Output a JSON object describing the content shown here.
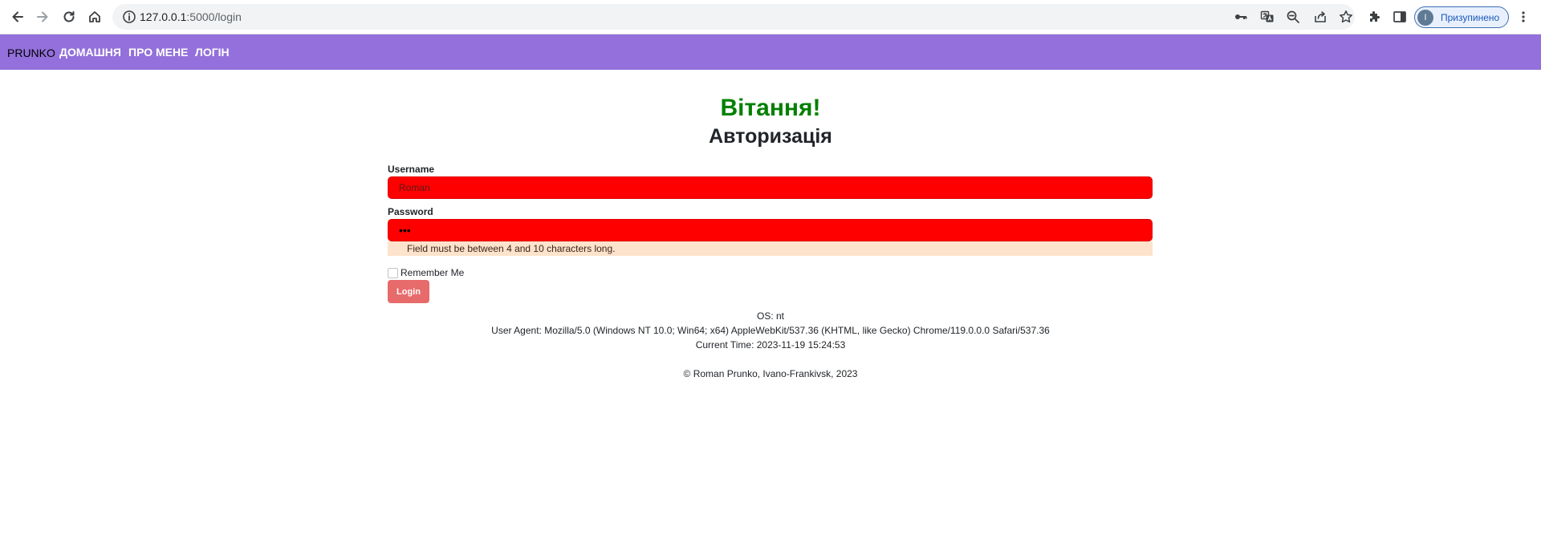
{
  "browser": {
    "url_host": "127.0.0.1",
    "url_rest": ":5000/login",
    "profile_initial": "I",
    "profile_label": "Призупинено"
  },
  "navbar": {
    "brand": "PRUNKO",
    "links": [
      "ДОМАШНЯ",
      "ПРО МЕНЕ",
      "ЛОГІН"
    ],
    "background": "#9370db"
  },
  "page": {
    "greeting": "Вітання!",
    "title": "Авторизація"
  },
  "form": {
    "username_label": "Username",
    "username_value": "Roman",
    "password_label": "Password",
    "password_mask": "•••",
    "error_message": "Field must be between 4 and 10 characters long.",
    "remember_label": "Remember Me",
    "remember_checked": false,
    "login_label": "Login"
  },
  "info": {
    "os": "OS: nt",
    "user_agent": "User Agent: Mozilla/5.0 (Windows NT 10.0; Win64; x64) AppleWebKit/537.36 (KHTML, like Gecko) Chrome/119.0.0.0 Safari/537.36",
    "current_time": "Current Time: 2023-11-19 15:24:53"
  },
  "footer": {
    "copyright": "© Roman Prunko, Ivano-Frankivsk, 2023"
  },
  "colors": {
    "greeting": "#008000",
    "input_error_bg": "#ff0000",
    "error_box_bg": "#fde2cc",
    "login_button": "#e86b6b"
  }
}
